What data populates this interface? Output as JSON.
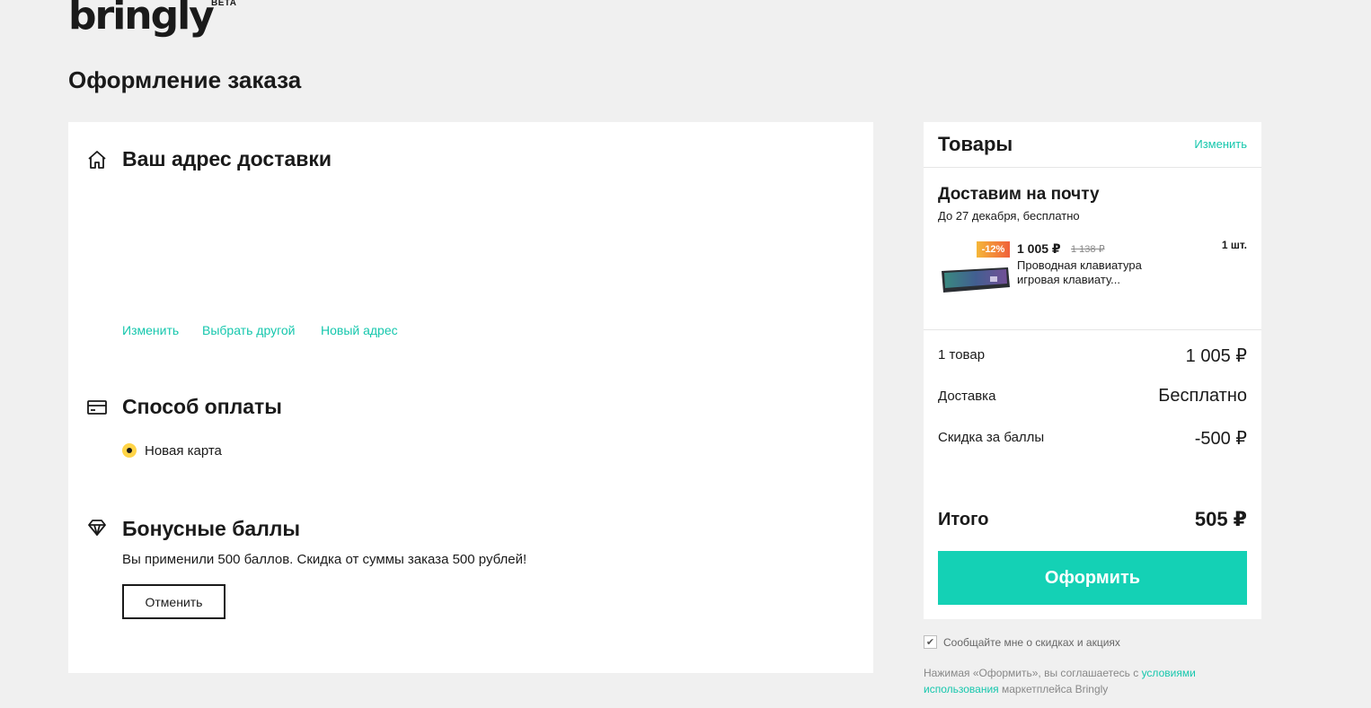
{
  "header": {
    "logo": "bringly",
    "logo_badge": "BETA",
    "page_title": "Оформление заказа"
  },
  "address": {
    "title": "Ваш адрес доставки",
    "icon": "home-icon",
    "actions": [
      "Изменить",
      "Выбрать другой",
      "Новый адрес"
    ]
  },
  "payment": {
    "title": "Способ оплаты",
    "icon": "card-icon",
    "option_label": "Новая карта"
  },
  "bonus": {
    "title": "Бонусные баллы",
    "icon": "diamond-icon",
    "text": "Вы применили 500 баллов. Скидка от суммы заказа 500 рублей!",
    "cancel_label": "Отменить"
  },
  "cart": {
    "title": "Товары",
    "edit_label": "Изменить",
    "delivery_title": "Доставим на почту",
    "delivery_sub": "До 27 декабря, бесплатно",
    "item": {
      "discount": "-12%",
      "price": "1 005 ₽",
      "old_price": "1 138 ₽",
      "name": "Проводная клавиатура игровая клавиату...",
      "qty": "1 шт."
    },
    "summary": {
      "items_label": "1 товар",
      "items_value": "1 005 ₽",
      "delivery_label": "Доставка",
      "delivery_value": "Бесплатно",
      "points_label": "Скидка за баллы",
      "points_value": "-500 ₽",
      "total_label": "Итого",
      "total_value": "505 ₽"
    },
    "submit_label": "Оформить"
  },
  "footer": {
    "subscribe_label": "Сообщайте мне о скидках и акциях",
    "subscribe_checked": true,
    "terms_prefix": "Нажимая «Оформить», вы соглашаетесь с ",
    "terms_link": "условиями использования",
    "terms_suffix": " маркетплейса Bringly"
  },
  "colors": {
    "accent": "#14d1b5",
    "link": "#16c7ad",
    "radio": "#ffd447",
    "background": "#f0f0f0"
  }
}
